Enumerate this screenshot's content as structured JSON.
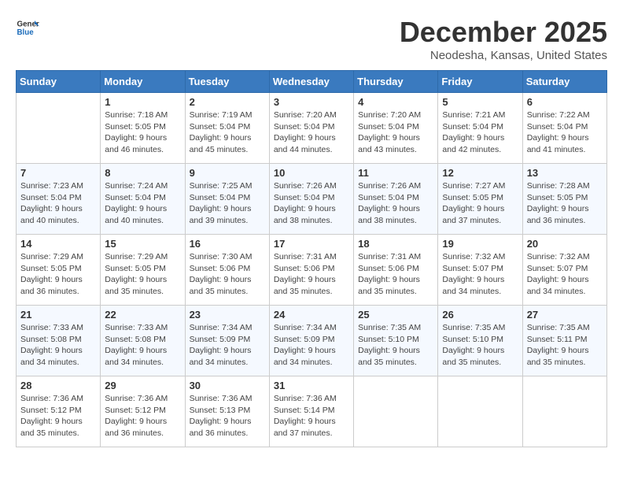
{
  "header": {
    "logo_line1": "General",
    "logo_line2": "Blue",
    "title": "December 2025",
    "subtitle": "Neodesha, Kansas, United States"
  },
  "days_of_week": [
    "Sunday",
    "Monday",
    "Tuesday",
    "Wednesday",
    "Thursday",
    "Friday",
    "Saturday"
  ],
  "weeks": [
    [
      {
        "day": "",
        "info": ""
      },
      {
        "day": "1",
        "info": "Sunrise: 7:18 AM\nSunset: 5:05 PM\nDaylight: 9 hours\nand 46 minutes."
      },
      {
        "day": "2",
        "info": "Sunrise: 7:19 AM\nSunset: 5:04 PM\nDaylight: 9 hours\nand 45 minutes."
      },
      {
        "day": "3",
        "info": "Sunrise: 7:20 AM\nSunset: 5:04 PM\nDaylight: 9 hours\nand 44 minutes."
      },
      {
        "day": "4",
        "info": "Sunrise: 7:20 AM\nSunset: 5:04 PM\nDaylight: 9 hours\nand 43 minutes."
      },
      {
        "day": "5",
        "info": "Sunrise: 7:21 AM\nSunset: 5:04 PM\nDaylight: 9 hours\nand 42 minutes."
      },
      {
        "day": "6",
        "info": "Sunrise: 7:22 AM\nSunset: 5:04 PM\nDaylight: 9 hours\nand 41 minutes."
      }
    ],
    [
      {
        "day": "7",
        "info": "Sunrise: 7:23 AM\nSunset: 5:04 PM\nDaylight: 9 hours\nand 40 minutes."
      },
      {
        "day": "8",
        "info": "Sunrise: 7:24 AM\nSunset: 5:04 PM\nDaylight: 9 hours\nand 40 minutes."
      },
      {
        "day": "9",
        "info": "Sunrise: 7:25 AM\nSunset: 5:04 PM\nDaylight: 9 hours\nand 39 minutes."
      },
      {
        "day": "10",
        "info": "Sunrise: 7:26 AM\nSunset: 5:04 PM\nDaylight: 9 hours\nand 38 minutes."
      },
      {
        "day": "11",
        "info": "Sunrise: 7:26 AM\nSunset: 5:04 PM\nDaylight: 9 hours\nand 38 minutes."
      },
      {
        "day": "12",
        "info": "Sunrise: 7:27 AM\nSunset: 5:05 PM\nDaylight: 9 hours\nand 37 minutes."
      },
      {
        "day": "13",
        "info": "Sunrise: 7:28 AM\nSunset: 5:05 PM\nDaylight: 9 hours\nand 36 minutes."
      }
    ],
    [
      {
        "day": "14",
        "info": "Sunrise: 7:29 AM\nSunset: 5:05 PM\nDaylight: 9 hours\nand 36 minutes."
      },
      {
        "day": "15",
        "info": "Sunrise: 7:29 AM\nSunset: 5:05 PM\nDaylight: 9 hours\nand 35 minutes."
      },
      {
        "day": "16",
        "info": "Sunrise: 7:30 AM\nSunset: 5:06 PM\nDaylight: 9 hours\nand 35 minutes."
      },
      {
        "day": "17",
        "info": "Sunrise: 7:31 AM\nSunset: 5:06 PM\nDaylight: 9 hours\nand 35 minutes."
      },
      {
        "day": "18",
        "info": "Sunrise: 7:31 AM\nSunset: 5:06 PM\nDaylight: 9 hours\nand 35 minutes."
      },
      {
        "day": "19",
        "info": "Sunrise: 7:32 AM\nSunset: 5:07 PM\nDaylight: 9 hours\nand 34 minutes."
      },
      {
        "day": "20",
        "info": "Sunrise: 7:32 AM\nSunset: 5:07 PM\nDaylight: 9 hours\nand 34 minutes."
      }
    ],
    [
      {
        "day": "21",
        "info": "Sunrise: 7:33 AM\nSunset: 5:08 PM\nDaylight: 9 hours\nand 34 minutes."
      },
      {
        "day": "22",
        "info": "Sunrise: 7:33 AM\nSunset: 5:08 PM\nDaylight: 9 hours\nand 34 minutes."
      },
      {
        "day": "23",
        "info": "Sunrise: 7:34 AM\nSunset: 5:09 PM\nDaylight: 9 hours\nand 34 minutes."
      },
      {
        "day": "24",
        "info": "Sunrise: 7:34 AM\nSunset: 5:09 PM\nDaylight: 9 hours\nand 34 minutes."
      },
      {
        "day": "25",
        "info": "Sunrise: 7:35 AM\nSunset: 5:10 PM\nDaylight: 9 hours\nand 35 minutes."
      },
      {
        "day": "26",
        "info": "Sunrise: 7:35 AM\nSunset: 5:10 PM\nDaylight: 9 hours\nand 35 minutes."
      },
      {
        "day": "27",
        "info": "Sunrise: 7:35 AM\nSunset: 5:11 PM\nDaylight: 9 hours\nand 35 minutes."
      }
    ],
    [
      {
        "day": "28",
        "info": "Sunrise: 7:36 AM\nSunset: 5:12 PM\nDaylight: 9 hours\nand 35 minutes."
      },
      {
        "day": "29",
        "info": "Sunrise: 7:36 AM\nSunset: 5:12 PM\nDaylight: 9 hours\nand 36 minutes."
      },
      {
        "day": "30",
        "info": "Sunrise: 7:36 AM\nSunset: 5:13 PM\nDaylight: 9 hours\nand 36 minutes."
      },
      {
        "day": "31",
        "info": "Sunrise: 7:36 AM\nSunset: 5:14 PM\nDaylight: 9 hours\nand 37 minutes."
      },
      {
        "day": "",
        "info": ""
      },
      {
        "day": "",
        "info": ""
      },
      {
        "day": "",
        "info": ""
      }
    ]
  ]
}
